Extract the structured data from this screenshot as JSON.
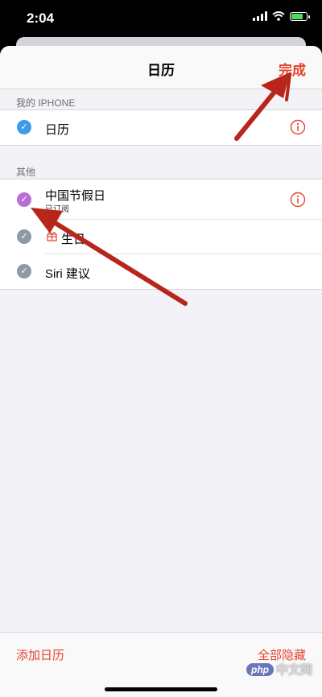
{
  "status_bar": {
    "time": "2:04"
  },
  "nav": {
    "title": "日历",
    "done_label": "完成"
  },
  "sections": [
    {
      "header": "我的 IPHONE",
      "items": [
        {
          "label": "日历",
          "check_color": "#3e9bea",
          "has_info": true
        }
      ]
    },
    {
      "header": "其他",
      "items": [
        {
          "label": "中国节假日",
          "subtitle": "已订阅",
          "check_color": "#b86fd2",
          "has_info": true
        },
        {
          "label": "生日",
          "check_color": "#8e99a8",
          "icon": "gift-icon"
        },
        {
          "label": "Siri 建议",
          "check_color": "#8e99a8"
        }
      ]
    }
  ],
  "bottom_bar": {
    "add_calendar_label": "添加日历",
    "hide_all_label": "全部隐藏"
  },
  "accent_color": "#e5432f",
  "annotation_color": "#b8261a",
  "watermark": {
    "logo": "php",
    "text": "中文网"
  }
}
